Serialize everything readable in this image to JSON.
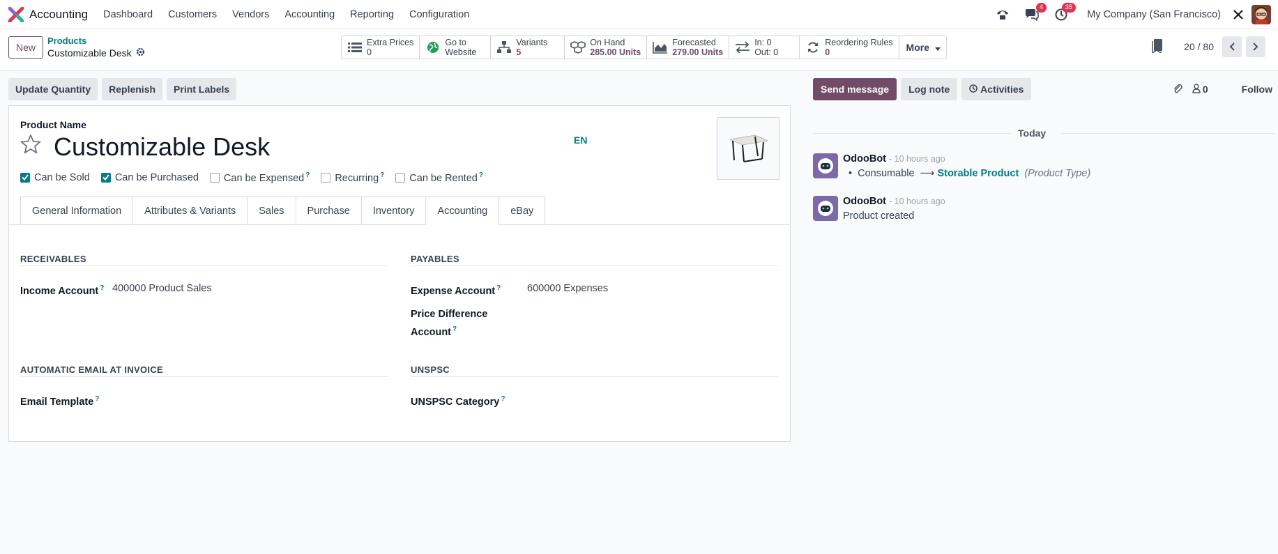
{
  "navbar": {
    "app_name": "Accounting",
    "menu": [
      "Dashboard",
      "Customers",
      "Vendors",
      "Accounting",
      "Reporting",
      "Configuration"
    ],
    "messages_badge": "4",
    "activities_badge": "35",
    "company": "My Company (San Francisco)"
  },
  "control": {
    "new_label": "New",
    "breadcrumb_parent": "Products",
    "breadcrumb_current": "Customizable Desk",
    "smart_buttons": [
      {
        "label": "Extra Prices",
        "value": "0",
        "icon": "list-icon"
      },
      {
        "label": "Go to",
        "value": "Website",
        "icon": "globe-icon"
      },
      {
        "label": "Variants",
        "value": "5",
        "icon": "sitemap-icon"
      },
      {
        "label": "On Hand",
        "value": "285.00 Units",
        "icon": "cubes-icon"
      },
      {
        "label": "Forecasted",
        "value": "279.00 Units",
        "icon": "area-chart-icon"
      },
      {
        "label": "In: 0",
        "value": "Out: 0",
        "icon": "exchange-icon"
      },
      {
        "label": "Reordering Rules",
        "value": "0",
        "icon": "refresh-icon"
      }
    ],
    "more_label": "More",
    "pager": "20 / 80"
  },
  "actions": [
    "Update Quantity",
    "Replenish",
    "Print Labels"
  ],
  "form": {
    "product_name_label": "Product Name",
    "product_name": "Customizable Desk",
    "lang": "EN",
    "checkboxes": [
      {
        "label": "Can be Sold",
        "checked": true,
        "help": false
      },
      {
        "label": "Can be Purchased",
        "checked": true,
        "help": false
      },
      {
        "label": "Can be Expensed",
        "checked": false,
        "help": true
      },
      {
        "label": "Recurring",
        "checked": false,
        "help": true
      },
      {
        "label": "Can be Rented",
        "checked": false,
        "help": true
      }
    ],
    "tabs": [
      "General Information",
      "Attributes & Variants",
      "Sales",
      "Purchase",
      "Inventory",
      "Accounting",
      "eBay"
    ],
    "active_tab": "Accounting",
    "receivables": {
      "title": "RECEIVABLES",
      "income_label": "Income Account",
      "income_value": "400000 Product Sales"
    },
    "payables": {
      "title": "PAYABLES",
      "expense_label": "Expense Account",
      "expense_value": "600000 Expenses",
      "price_diff_label_1": "Price Difference",
      "price_diff_label_2": "Account"
    },
    "auto_email": {
      "title": "AUTOMATIC EMAIL AT INVOICE",
      "template_label": "Email Template"
    },
    "unspsc": {
      "title": "UNSPSC",
      "category_label": "UNSPSC Category"
    },
    "help_mark": "?"
  },
  "chatter": {
    "send_message": "Send message",
    "log_note": "Log note",
    "activities": "Activities",
    "followers_count": "0",
    "follow": "Follow",
    "today": "Today",
    "messages": [
      {
        "author": "OdooBot",
        "time": "- 10 hours ago",
        "old_value": "Consumable",
        "arrow": "⟶",
        "new_value": "Storable Product",
        "field": "(Product Type)"
      },
      {
        "author": "OdooBot",
        "time": "- 10 hours ago",
        "body": "Product created"
      }
    ]
  },
  "colors": {
    "brand": "#714b67",
    "accent": "#017e84",
    "badge": "#e0344f"
  }
}
